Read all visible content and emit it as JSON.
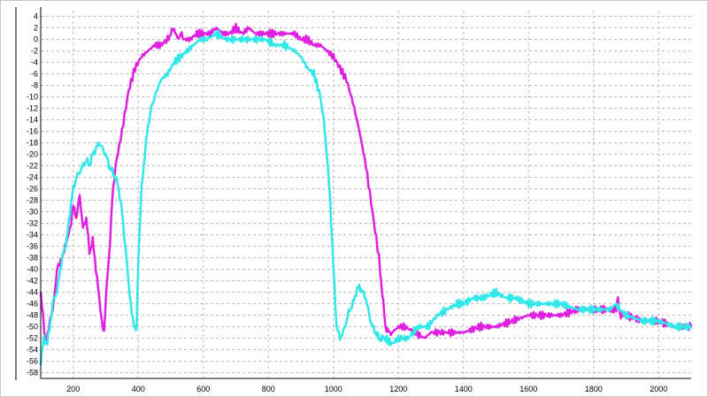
{
  "chart_data": {
    "type": "line",
    "title": "",
    "xlabel": "",
    "ylabel": "",
    "xlim": [
      100,
      2100
    ],
    "ylim": [
      -59,
      5
    ],
    "grid": true,
    "x_ticks": [
      200,
      400,
      600,
      800,
      1000,
      1200,
      1400,
      1600,
      1800,
      2000
    ],
    "y_ticks": [
      4,
      2,
      0,
      -2,
      -4,
      -6,
      -8,
      -10,
      -12,
      -14,
      -16,
      -18,
      -20,
      -22,
      -24,
      -26,
      -28,
      -30,
      -32,
      -34,
      -36,
      -38,
      -40,
      -42,
      -44,
      -46,
      -48,
      -50,
      -52,
      -54,
      -56,
      -58
    ],
    "colors": {
      "series_magenta": "#e020e0",
      "series_cyan": "#30e8e8",
      "grid": "#bdbdbd",
      "axis": "#000000"
    },
    "series": [
      {
        "color": "#e020e0",
        "x": [
          100,
          115,
          125,
          140,
          150,
          165,
          175,
          190,
          200,
          210,
          220,
          230,
          240,
          250,
          260,
          270,
          280,
          290,
          295,
          300,
          310,
          320,
          330,
          350,
          370,
          390,
          410,
          430,
          450,
          470,
          490,
          500,
          510,
          520,
          530,
          540,
          560,
          580,
          600,
          620,
          640,
          660,
          680,
          700,
          720,
          740,
          760,
          780,
          800,
          820,
          840,
          860,
          880,
          900,
          920,
          940,
          960,
          980,
          1000,
          1020,
          1040,
          1060,
          1080,
          1100,
          1120,
          1140,
          1150,
          1160,
          1170,
          1180,
          1200,
          1220,
          1250,
          1280,
          1300,
          1330,
          1360,
          1400,
          1450,
          1500,
          1550,
          1600,
          1650,
          1700,
          1750,
          1800,
          1850,
          1870,
          1875,
          1880,
          1900,
          1950,
          2000,
          2050,
          2100
        ],
        "y": [
          -44,
          -53,
          -50,
          -46,
          -40,
          -38,
          -36,
          -33,
          -29,
          -31,
          -27,
          -33,
          -31,
          -37,
          -35,
          -40,
          -45,
          -50,
          -51,
          -45,
          -38,
          -28,
          -22,
          -16,
          -9,
          -5,
          -3,
          -2,
          -1,
          -1,
          0,
          1,
          2,
          0,
          1,
          0,
          0,
          1,
          1,
          1,
          2,
          1,
          1,
          2,
          1,
          2,
          1,
          1,
          1,
          1,
          1,
          1,
          1,
          0,
          0,
          -1,
          -1,
          -2,
          -3,
          -5,
          -7,
          -11,
          -16,
          -22,
          -30,
          -38,
          -44,
          -50,
          -51,
          -51,
          -50,
          -50,
          -51,
          -52,
          -51,
          -51,
          -51,
          -51,
          -50,
          -50,
          -49,
          -48,
          -48,
          -48,
          -47,
          -47,
          -47,
          -47,
          -45,
          -48,
          -48,
          -49,
          -49,
          -50,
          -50
        ],
        "line": []
      },
      {
        "color": "#30e8e8",
        "x": [
          100,
          110,
          120,
          130,
          140,
          150,
          160,
          170,
          180,
          190,
          200,
          210,
          220,
          230,
          240,
          250,
          260,
          270,
          280,
          290,
          300,
          310,
          320,
          330,
          340,
          350,
          360,
          370,
          380,
          390,
          395,
          400,
          410,
          420,
          430,
          440,
          450,
          470,
          490,
          510,
          530,
          550,
          570,
          590,
          610,
          640,
          670,
          700,
          730,
          760,
          790,
          820,
          850,
          880,
          900,
          920,
          940,
          960,
          970,
          980,
          990,
          1000,
          1010,
          1020,
          1030,
          1040,
          1050,
          1060,
          1070,
          1080,
          1090,
          1100,
          1110,
          1120,
          1130,
          1140,
          1150,
          1160,
          1180,
          1200,
          1230,
          1260,
          1290,
          1320,
          1350,
          1380,
          1400,
          1430,
          1460,
          1500,
          1530,
          1560,
          1600,
          1650,
          1700,
          1750,
          1800,
          1850,
          1870,
          1880,
          1900,
          1950,
          2000,
          2050,
          2100
        ],
        "y": [
          -56,
          -52,
          -53,
          -49,
          -45,
          -44,
          -40,
          -37,
          -35,
          -30,
          -26,
          -24,
          -23,
          -22,
          -21,
          -22,
          -20,
          -19,
          -18,
          -19,
          -20,
          -22,
          -23,
          -24,
          -26,
          -30,
          -36,
          -42,
          -48,
          -50,
          -50,
          -38,
          -26,
          -20,
          -15,
          -12,
          -10,
          -7,
          -6,
          -4,
          -3,
          -2,
          -1,
          0,
          0,
          1,
          0,
          0,
          0,
          0,
          0,
          -1,
          -1,
          -2,
          -3,
          -5,
          -6,
          -10,
          -14,
          -20,
          -28,
          -40,
          -50,
          -52,
          -51,
          -49,
          -47,
          -46,
          -44,
          -43,
          -44,
          -45,
          -48,
          -50,
          -51,
          -52,
          -52,
          -52,
          -53,
          -52,
          -52,
          -50,
          -50,
          -48,
          -47,
          -46,
          -46,
          -45,
          -45,
          -44,
          -45,
          -45,
          -46,
          -46,
          -46,
          -47,
          -47,
          -47,
          -46,
          -47,
          -48,
          -49,
          -49,
          -50,
          -50
        ],
        "line": []
      }
    ]
  }
}
